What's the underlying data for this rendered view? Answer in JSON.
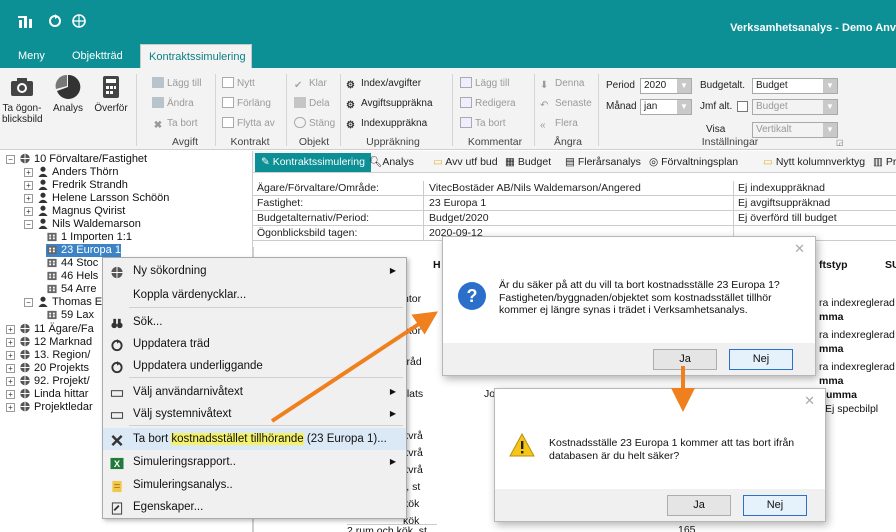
{
  "title_bar": {
    "app_title": "Verksamhetsanalys - Demo Anv"
  },
  "menu_tabs": [
    "Meny",
    "Objektträd",
    "Kontraktssimulering"
  ],
  "ribbon": {
    "big_buttons": [
      "Ta ögon-\nblicksbild",
      "Analys",
      "Överför"
    ],
    "avgift": {
      "items": [
        "Lägg till",
        "Ändra",
        "Ta bort"
      ],
      "label": "Avgift"
    },
    "kontrakt": {
      "items": [
        "Nytt",
        "Förläng",
        "Flytta av"
      ],
      "label": "Kontrakt"
    },
    "objekt": {
      "items": [
        "Klar",
        "Dela",
        "Stäng"
      ],
      "label": "Objekt"
    },
    "uppräkning": {
      "items": [
        "Index/avgifter",
        "Avgiftsuppräkna",
        "Indexuppräkna"
      ],
      "label": "Uppräkning"
    },
    "kommentar": {
      "items": [
        "Lägg till",
        "Redigera",
        "Ta bort"
      ],
      "label": "Kommentar"
    },
    "angra": {
      "items": [
        "Denna",
        "Senaste",
        "Flera"
      ],
      "label": "Ångra"
    },
    "installningar": {
      "label": "Inställningar",
      "period_label": "Period",
      "period_value": "2020",
      "manad_label": "Månad",
      "manad_value": "jan",
      "budgetalt_label": "Budgetalt.",
      "budgetalt_value": "Budget",
      "jmf_label": "Jmf alt.",
      "jmf_value": "Budget",
      "visa_label": "Visa",
      "visa_value": "Vertikalt"
    }
  },
  "tree": [
    {
      "label": "10 Förvaltare/Fastighet",
      "exp": "−"
    },
    {
      "label": "Anders Thörn",
      "exp": "+"
    },
    {
      "label": "Fredrik Strandh",
      "exp": "+"
    },
    {
      "label": "Helene Larsson Schöön",
      "exp": "+"
    },
    {
      "label": "Magnus Qvirist",
      "exp": "+"
    },
    {
      "label": "Nils Waldemarson",
      "exp": "−"
    },
    {
      "label": "1 Importen 1:1",
      "exp": ""
    },
    {
      "label": "23 Europa 1",
      "exp": ""
    },
    {
      "label": "44 Stoc",
      "exp": ""
    },
    {
      "label": "46 Hels",
      "exp": ""
    },
    {
      "label": "54 Arre",
      "exp": ""
    },
    {
      "label": "Thomas E",
      "exp": "−"
    },
    {
      "label": "59 Lax",
      "exp": ""
    },
    {
      "label": "11 Ägare/Fa",
      "exp": "+"
    },
    {
      "label": "12 Marknad",
      "exp": "+"
    },
    {
      "label": "13. Region/",
      "exp": "+"
    },
    {
      "label": "20 Projekts",
      "exp": "+"
    },
    {
      "label": "92. Projekt/",
      "exp": "+"
    },
    {
      "label": "Linda hittar",
      "exp": "+"
    },
    {
      "label": "Projektledar",
      "exp": "+"
    }
  ],
  "panel_tabs": [
    "Kontraktssimulering",
    "Analys",
    "Avv utf bud",
    "Budget",
    "Flerårsanalys",
    "Förvaltningsplan",
    "Nytt kolumnverktyg",
    "Progn"
  ],
  "info_rows": [
    [
      "Ägare/Förvaltare/Område:",
      "VitecBostäder AB/Nils Waldemarson/Angered",
      "Ej indexuppräknad"
    ],
    [
      "Fastighet:",
      "23 Europa 1",
      "Ej avgiftsuppräknad"
    ],
    [
      "Budgetalternativ/Period:",
      "Budget/2020",
      "Ej överförd till budget"
    ],
    [
      "Ögonblicksbild tagen:",
      "2020-09-12",
      ""
    ]
  ],
  "grid": {
    "header_h": "H",
    "header_avgiftstyp": "ftstyp",
    "header_su": "SU",
    "left_cells": [
      "ntor",
      "ntor",
      "rråd",
      "plats",
      "kvrå",
      "kvrå",
      "kvrå",
      "k, st",
      "kök",
      "kök",
      "kök"
    ],
    "jo": "Jo",
    "right_cells": [
      "ra indexreglerad",
      "mma",
      "ra indexreglerad",
      "mma",
      "ra indexreglerad",
      "mma",
      "Summa",
      "Ej specbilpl"
    ],
    "bottom_row": "2 rum och kök, st",
    "bottom_value": "165"
  },
  "context_menu": {
    "items": [
      {
        "label": "Ny sökordning",
        "submenu": true,
        "icon": "globe-icon"
      },
      {
        "label": "Koppla värdenycklar...",
        "submenu": false,
        "icon": ""
      },
      {
        "label": "Sök...",
        "submenu": false,
        "icon": "binoculars-icon"
      },
      {
        "label": "Uppdatera träd",
        "submenu": false,
        "icon": "refresh-icon"
      },
      {
        "label": "Uppdatera underliggande",
        "submenu": false,
        "icon": "refresh-icon"
      },
      {
        "label": "Välj användarnivåtext",
        "submenu": true,
        "icon": "textbox-icon"
      },
      {
        "label": "Välj systemnivåtext",
        "submenu": true,
        "icon": "textbox-icon"
      },
      {
        "label_prefix": "Ta bort ",
        "label_highlight": "kostnadsstället tillhörande",
        "label_suffix": " (23 Europa 1)...",
        "submenu": false,
        "icon": "delete-x-icon"
      },
      {
        "label": "Simuleringsrapport..",
        "submenu": true,
        "icon": "excel-icon"
      },
      {
        "label": "Simuleringsanalys..",
        "submenu": false,
        "icon": "sheet-icon"
      },
      {
        "label": "Egenskaper...",
        "submenu": false,
        "icon": "properties-icon"
      }
    ]
  },
  "dialog1": {
    "text": "Är du säker på att du vill ta bort kostnadsställe 23 Europa 1?\nFastigheten/byggnaden/objektet som kostnadsstället tillhör\nkommer ej längre synas i trädet i Verksamhetsanalys.",
    "yes": "Ja",
    "no": "Nej"
  },
  "dialog2": {
    "text": "Kostnadsställe 23 Europa 1 kommer att tas bort ifrån\ndatabasen är du helt säker?",
    "yes": "Ja",
    "no": "Nej"
  },
  "colors": {
    "accent": "#0c8f95",
    "arrow": "#f07f1e",
    "selection": "#3c84c6",
    "highlight": "#f4f26b"
  }
}
